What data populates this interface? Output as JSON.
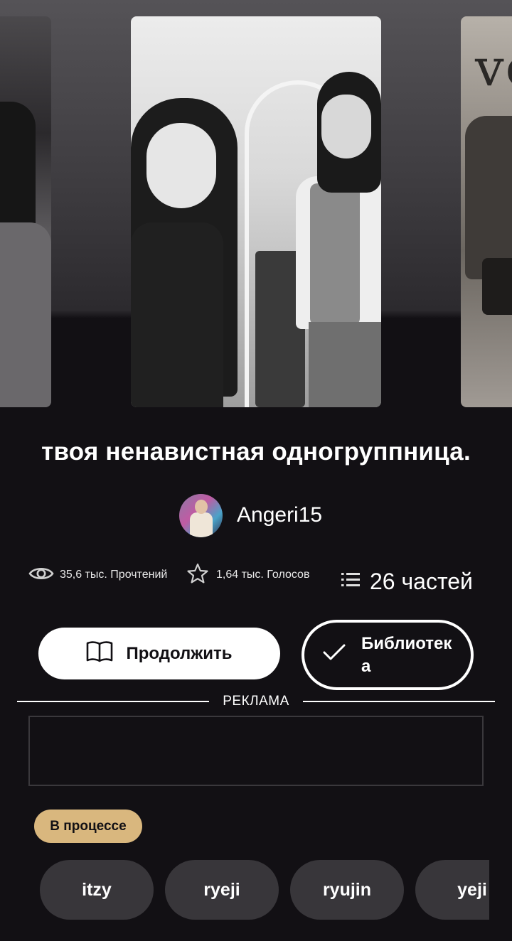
{
  "story": {
    "title": "твоя ненавистная одногруппница.",
    "author": "Angeri15",
    "status": "В процессе"
  },
  "stats": {
    "reads": "35,6 тыс. Прочтений",
    "votes": "1,64 тыс. Голосов",
    "parts": "26 частей"
  },
  "actions": {
    "continue_label": "Продолжить",
    "library_label": "Библиотека"
  },
  "ad": {
    "label": "РЕКЛАМА"
  },
  "cover_right_text": "ve",
  "tags": [
    "itzy",
    "ryeji",
    "ryujin",
    "yeji"
  ],
  "icons": {
    "reads": "eye-icon",
    "votes": "star-icon",
    "parts": "list-icon",
    "continue": "book-icon",
    "library": "check-icon"
  },
  "colors": {
    "background": "#121014",
    "status_badge": "#d9b77e",
    "tag_background": "#38363a"
  }
}
